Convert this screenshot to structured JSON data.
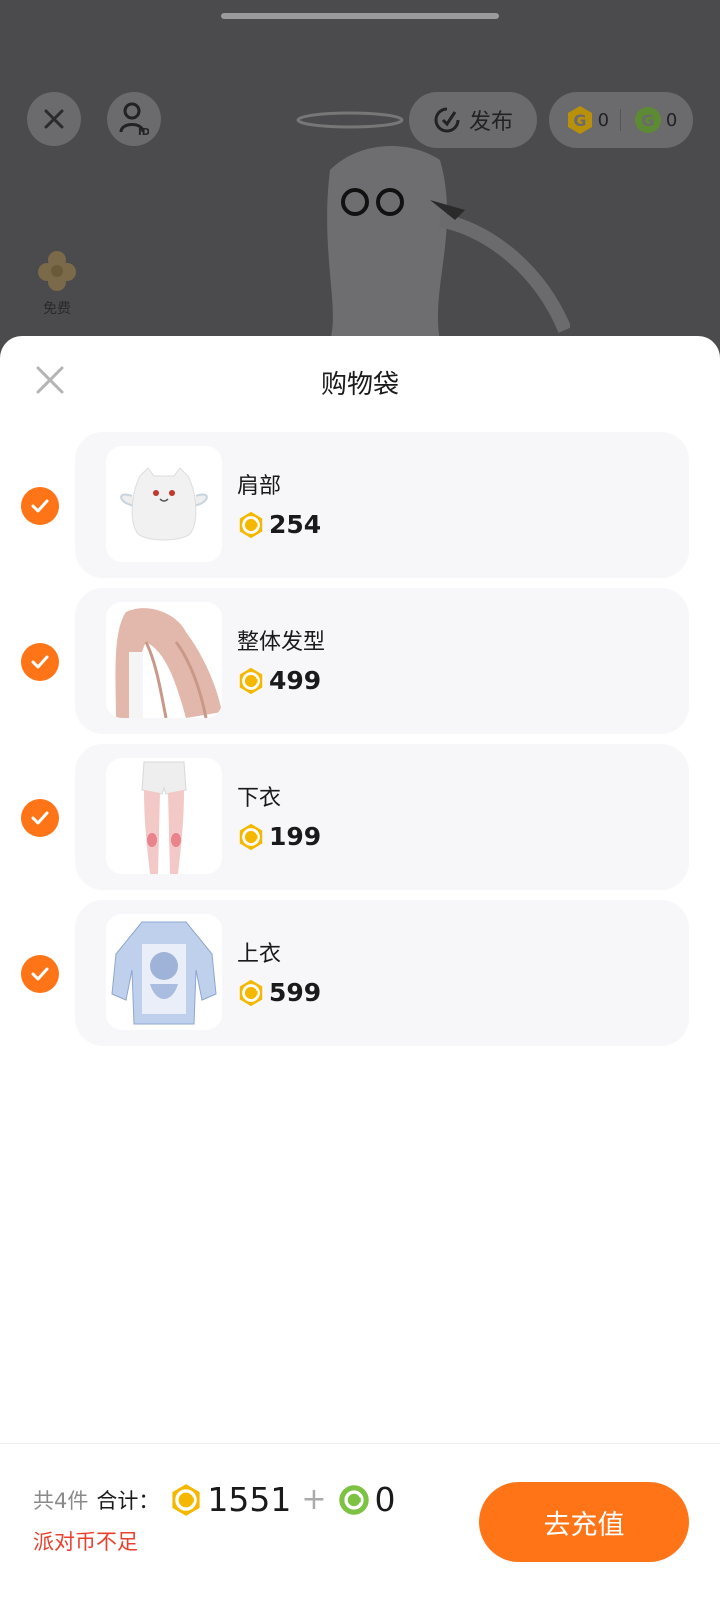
{
  "top_bar": {
    "publish_label": "发布",
    "gold_coin_balance": "0",
    "green_coin_balance": "0",
    "free_label": "免费"
  },
  "sheet": {
    "title": "购物袋",
    "items": [
      {
        "name": "肩部",
        "price": "254",
        "checked": true
      },
      {
        "name": "整体发型",
        "price": "499",
        "checked": true
      },
      {
        "name": "下衣",
        "price": "199",
        "checked": true
      },
      {
        "name": "上衣",
        "price": "599",
        "checked": true
      }
    ]
  },
  "footer": {
    "count_label": "共4件",
    "total_label": "合计：",
    "gold_total": "1551",
    "plus": "+",
    "green_total": "0",
    "warning": "派对币不足",
    "recharge_label": "去充值"
  },
  "colors": {
    "accent": "#ff7416",
    "warning": "#e8412e",
    "gold_coin": "#f5b800",
    "green_coin": "#7dc242",
    "card_bg": "#f7f7fa"
  }
}
